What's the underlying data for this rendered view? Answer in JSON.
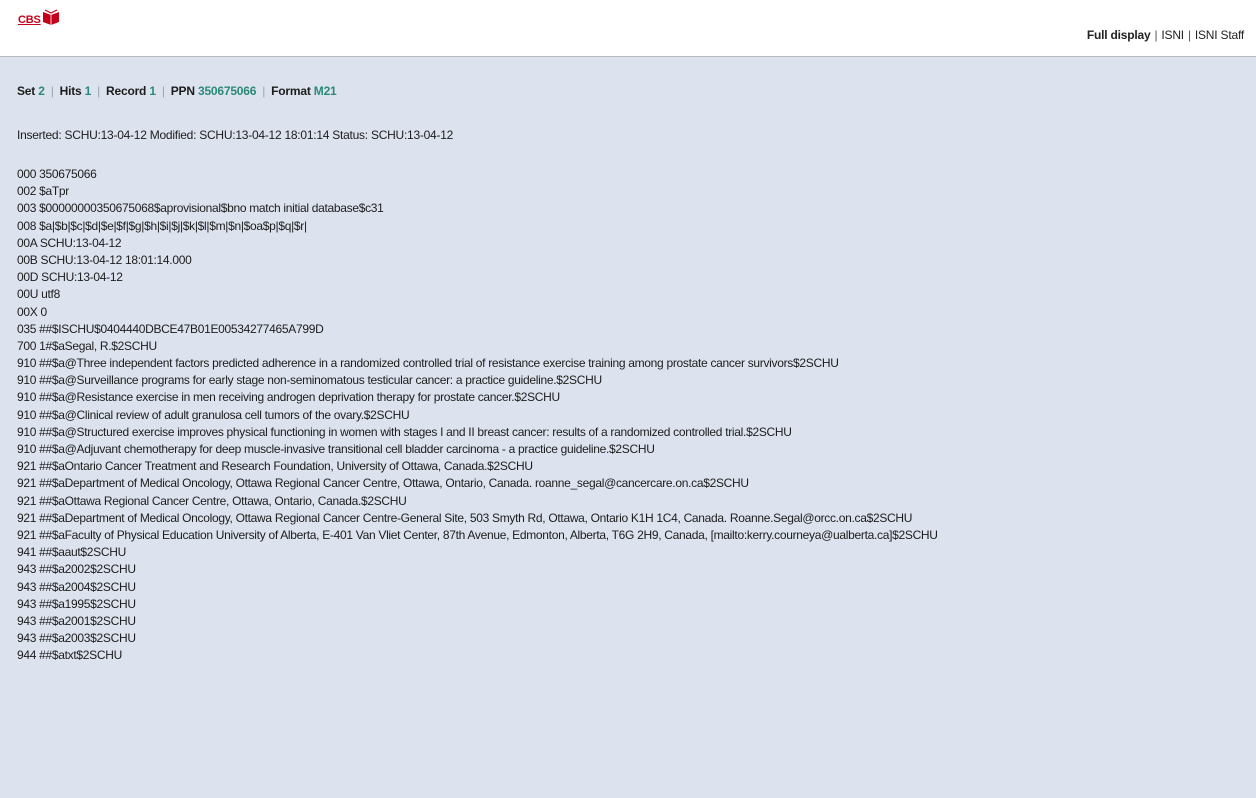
{
  "logo": {
    "text": "CBS"
  },
  "nav": {
    "items": [
      "Full display",
      "ISNI",
      "ISNI Staff"
    ],
    "separator": "|",
    "active_index": 0
  },
  "info": {
    "set_label": "Set",
    "set_value": "2",
    "hits_label": "Hits",
    "hits_value": "1",
    "record_label": "Record",
    "record_value": "1",
    "ppn_label": "PPN",
    "ppn_value": "350675066",
    "format_label": "Format",
    "format_value": "M21",
    "separator": "|"
  },
  "status_line": "Inserted: SCHU:13-04-12 Modified: SCHU:13-04-12 18:01:14 Status: SCHU:13-04-12",
  "record_lines": [
    "000 350675066",
    "002 $aTpr",
    "003 $00000000350675068$aprovisional$bno match initial database$c31",
    "008 $a|$b|$c|$d|$e|$f|$g|$h|$i|$j|$k|$l|$m|$n|$oa$p|$q|$r|",
    "00A SCHU:13-04-12",
    "00B SCHU:13-04-12 18:01:14.000",
    "00D SCHU:13-04-12",
    "00U utf8",
    "00X 0",
    "035 ##$ISCHU$0404440DBCE47B01E00534277465A799D",
    "700 1#$aSegal, R.$2SCHU",
    "910 ##$a@Three independent factors predicted adherence in a randomized controlled trial of resistance exercise training among prostate cancer survivors$2SCHU",
    "910 ##$a@Surveillance programs for early stage non-seminomatous testicular cancer: a practice guideline.$2SCHU",
    "910 ##$a@Resistance exercise in men receiving androgen deprivation therapy for prostate cancer.$2SCHU",
    "910 ##$a@Clinical review of adult granulosa cell tumors of the ovary.$2SCHU",
    "910 ##$a@Structured exercise improves physical functioning in women with stages I and II breast cancer: results of a randomized controlled trial.$2SCHU",
    "910 ##$a@Adjuvant chemotherapy for deep muscle-invasive transitional cell bladder carcinoma - a practice guideline.$2SCHU",
    "921 ##$aOntario Cancer Treatment and Research Foundation, University of Ottawa, Canada.$2SCHU",
    "921 ##$aDepartment of Medical Oncology, Ottawa Regional Cancer Centre, Ottawa, Ontario, Canada. roanne_segal@cancercare.on.ca$2SCHU",
    "921 ##$aOttawa Regional Cancer Centre, Ottawa, Ontario, Canada.$2SCHU",
    "921 ##$aDepartment of Medical Oncology, Ottawa Regional Cancer Centre-General Site, 503 Smyth Rd, Ottawa, Ontario K1H 1C4, Canada. Roanne.Segal@orcc.on.ca$2SCHU",
    "921 ##$aFaculty of Physical Education University of Alberta, E-401 Van Vliet Center, 87th Avenue, Edmonton, Alberta, T6G 2H9, Canada, [mailto:kerry.courneya@ualberta.ca]$2SCHU",
    "941 ##$aaut$2SCHU",
    "943 ##$a2002$2SCHU",
    "943 ##$a2004$2SCHU",
    "943 ##$a1995$2SCHU",
    "943 ##$a2001$2SCHU",
    "943 ##$a2003$2SCHU",
    "944 ##$atxt$2SCHU"
  ],
  "colors": {
    "content_bg": "#dde3ee",
    "accent_value": "#2a8a7a",
    "logo_red": "#c4001a"
  }
}
